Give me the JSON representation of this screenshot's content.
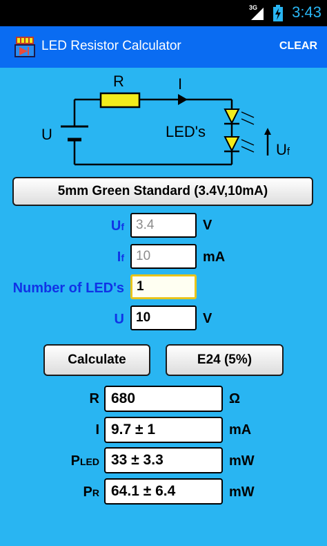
{
  "status_bar": {
    "network": "3G",
    "time": "3:43"
  },
  "app_bar": {
    "title": "LED Resistor Calculator",
    "clear_label": "CLEAR"
  },
  "circuit": {
    "resistor_label": "R",
    "current_label": "I",
    "source_label": "U",
    "led_label": "LED's",
    "vf_main": "U",
    "vf_sub": "f"
  },
  "preset": {
    "label": "5mm Green Standard (3.4V,10mA)"
  },
  "inputs": {
    "uf": {
      "label_main": "U",
      "label_sub": "f",
      "value": "3.4",
      "unit": "V"
    },
    "if": {
      "label_main": "I",
      "label_sub": "f",
      "value": "10",
      "unit": "mA"
    },
    "num_leds": {
      "label": "Number of LED's",
      "value": "1"
    },
    "u": {
      "label": "U",
      "value": "10",
      "unit": "V"
    }
  },
  "buttons": {
    "calculate": "Calculate",
    "series": "E24 (5%)"
  },
  "results": {
    "r": {
      "label": "R",
      "value": "680",
      "unit": "Ω"
    },
    "i": {
      "label": "I",
      "value": "9.7 ± 1",
      "unit": "mA"
    },
    "pled": {
      "label_main": "P",
      "label_sub": "LED",
      "value": "33 ± 3.3",
      "unit": "mW"
    },
    "pr": {
      "label_main": "P",
      "label_sub": "R",
      "value": "64.1 ± 6.4",
      "unit": "mW"
    }
  },
  "colors": {
    "background": "#29b5f2",
    "app_bar": "#0a6cf2",
    "label_blue": "#1033e6",
    "resistor": "#f2ec1c",
    "led": "#f2ec1c",
    "focus_border": "#e8c41c"
  }
}
